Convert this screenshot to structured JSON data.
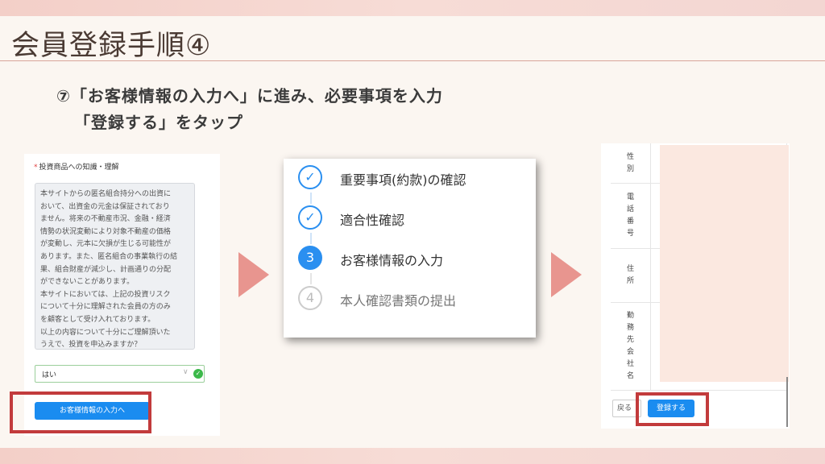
{
  "slide": {
    "title": "会員登録手順④",
    "instruction_line1": "⑦「お客様情報の入力へ」に進み、必要事項を入力",
    "instruction_line2": "「登録する」をタップ"
  },
  "form_panel": {
    "field_label": "投資商品への知識・理解",
    "required_mark": "*",
    "disclaimer": "本サイトからの匿名組合持分への出資に\nおいて、出資金の元金は保証されており\nません。将来の不動産市況、金融・経済\n情勢の状況変動により対象不動産の価格\nが変動し、元本に欠損が生じる可能性が\nあります。また、匿名組合の事業執行の結\n果、組合財産が減少し、計画通りの分配\nができないことがあります。\n本サイトにおいては、上記の投資リスク\nについて十分に理解された会員の方のみ\nを顧客として受け入れております。\n以上の内容について十分にご理解頂いた\nうえで、投資を申込みますか？",
    "select_value": "はい",
    "next_button": "お客様情報の入力へ"
  },
  "steps_panel": {
    "steps": [
      {
        "number": "✓",
        "label": "重要事項(約款)の確認",
        "state": "done"
      },
      {
        "number": "✓",
        "label": "適合性確認",
        "state": "done"
      },
      {
        "number": "3",
        "label": "お客様情報の入力",
        "state": "active"
      },
      {
        "number": "4",
        "label": "本人確認書類の提出",
        "state": "pending"
      }
    ]
  },
  "register_panel": {
    "rows": [
      {
        "label": "性別"
      },
      {
        "label": "電話番号"
      },
      {
        "label": "住所"
      },
      {
        "label": "勤務先会社名"
      }
    ],
    "back_button": "戻る",
    "submit_button": "登録する"
  },
  "colors": {
    "highlight": "#c23b3c",
    "primary_button": "#1a8cf0",
    "arrow": "#e8958f"
  }
}
